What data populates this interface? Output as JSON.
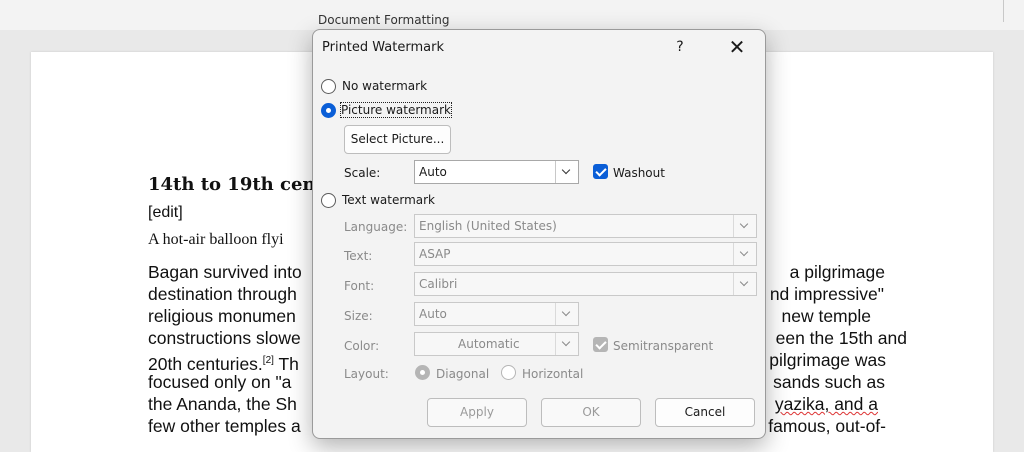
{
  "ribbon": {
    "group_label": "Document Formatting"
  },
  "document": {
    "heading": "14th to 19th cen",
    "edit_link": "[edit]",
    "caption": "A hot-air balloon flyi",
    "left_lines": [
      "Bagan survived into",
      "destination through",
      "religious monumen",
      "constructions slowe",
      "20th centuries.",
      "focused only on \"a",
      "the Ananda, the Sh",
      "few other temples a"
    ],
    "citation": "[2]",
    "left_line6_tail": " Th",
    "right_lines": [
      "a pilgrimage",
      "nd impressive\"",
      "new temple",
      "een the 15th and",
      "pilgrimage was",
      "sands such as",
      "yazika, and a",
      "famous, out-of-"
    ]
  },
  "dialog": {
    "title": "Printed Watermark",
    "help_label": "?",
    "close_label": "✕",
    "no_watermark_label": "No watermark",
    "picture_watermark_label": "Picture watermark",
    "select_picture_label": "Select Picture...",
    "scale_label": "Scale:",
    "scale_value": "Auto",
    "washout_label": "Washout",
    "text_watermark_label": "Text watermark",
    "language_label": "Language:",
    "language_value": "English (United States)",
    "text_label": "Text:",
    "text_value": "ASAP",
    "font_label": "Font:",
    "font_value": "Calibri",
    "size_label": "Size:",
    "size_value": "Auto",
    "color_label": "Color:",
    "color_value": "Automatic",
    "semitransparent_label": "Semitransparent",
    "layout_label": "Layout:",
    "diagonal_label": "Diagonal",
    "horizontal_label": "Horizontal",
    "apply_label": "Apply",
    "ok_label": "OK",
    "cancel_label": "Cancel"
  },
  "colors": {
    "accent": "#0a5ed7",
    "dialog_bg": "#f3f3f3"
  }
}
